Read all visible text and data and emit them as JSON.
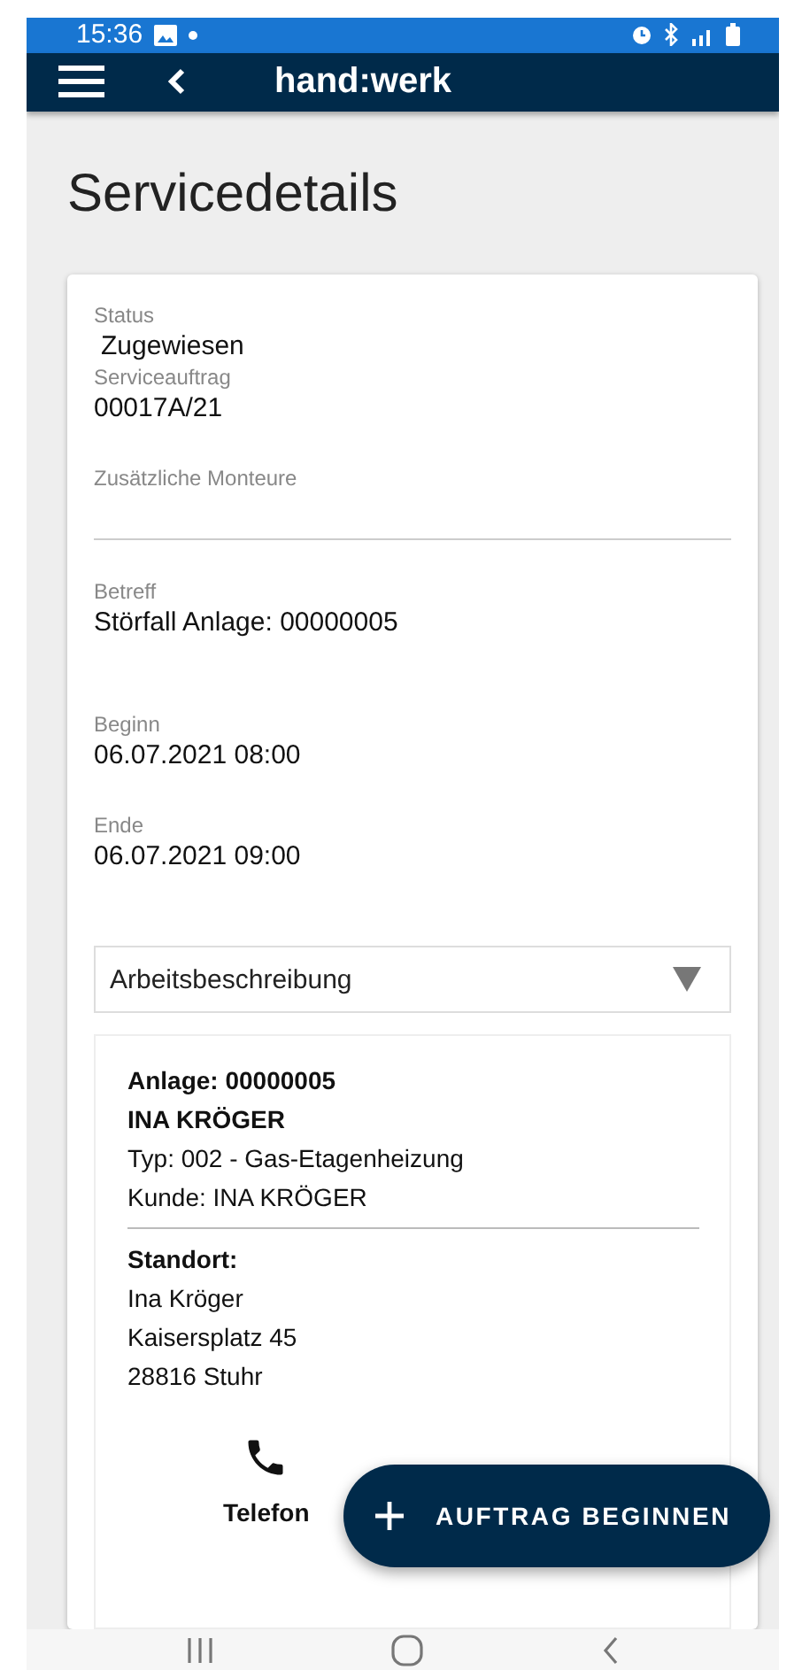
{
  "status_bar": {
    "time": "15:36"
  },
  "app_bar": {
    "title": "hand:werk"
  },
  "page_title": "Servicedetails",
  "fields": [
    {
      "kind": "text",
      "label": "Status",
      "value": "Zugewiesen"
    },
    {
      "kind": "text",
      "label": "Serviceauftrag",
      "value": "00017A/21"
    },
    {
      "kind": "input",
      "label": "Zusätzliche Monteure"
    },
    {
      "kind": "text",
      "label": "Betreff",
      "value": "Störfall Anlage: 00000005"
    },
    {
      "kind": "text",
      "label": "Beginn",
      "value": "06.07.2021 08:00"
    },
    {
      "kind": "text",
      "label": "Ende",
      "value": "06.07.2021 09:00"
    }
  ],
  "dropdown": {
    "label": "Arbeitsbeschreibung",
    "expanded": false
  },
  "asset_card": {
    "header_lines": [
      {
        "text": "Anlage: 00000005",
        "bold": true
      },
      {
        "text": "INA KRÖGER",
        "bold": true
      },
      {
        "text": "Typ: 002 - Gas-Etagenheizung",
        "bold": false
      },
      {
        "text": "Kunde: INA KRÖGER",
        "bold": false
      }
    ],
    "location_title": "Standort:",
    "location_lines": [
      "Ina Kröger",
      "Kaisersplatz 45",
      "28816 Stuhr"
    ],
    "actions": [
      {
        "label": "Telefon"
      }
    ]
  },
  "fab": {
    "label": "AUFTRAG BEGINNEN"
  }
}
